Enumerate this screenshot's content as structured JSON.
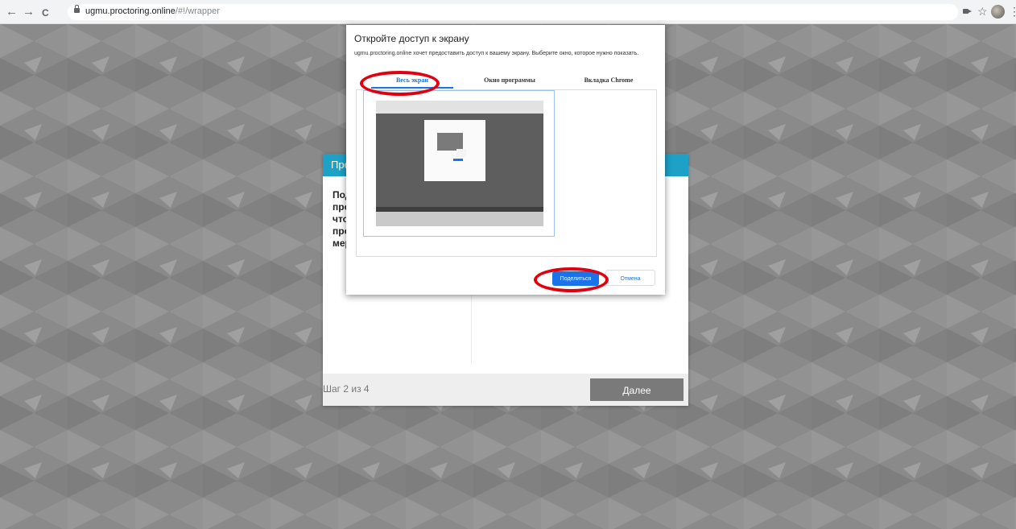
{
  "browser": {
    "nav_back": "←",
    "nav_forward": "→",
    "nav_reload": "C",
    "url_host": "ugmu.proctoring.online",
    "url_path": "/#!/wrapper",
    "star": "☆",
    "menu": "⋮"
  },
  "wizard": {
    "header": "Про",
    "body_lines": [
      "Под",
      "про",
      "что",
      "про",
      "мер"
    ],
    "step_label": "Шаг 2 из 4",
    "next_label": "Далее"
  },
  "dialog": {
    "title": "Откройте доступ к экрану",
    "description": "ugmu.proctoring.online хочет предоставить доступ к вашему экрану. Выберите окно, которое нужно показать.",
    "tabs": [
      {
        "label": "Весь экран",
        "active": true
      },
      {
        "label": "Окно программы",
        "active": false
      },
      {
        "label": "Вкладка Chrome",
        "active": false
      }
    ],
    "share_label": "Поделиться",
    "cancel_label": "Отмена"
  },
  "colors": {
    "accent": "#1a73e8",
    "header_bar": "#1da1c6",
    "annotation": "#e00010",
    "background": "#8a8a8a"
  }
}
